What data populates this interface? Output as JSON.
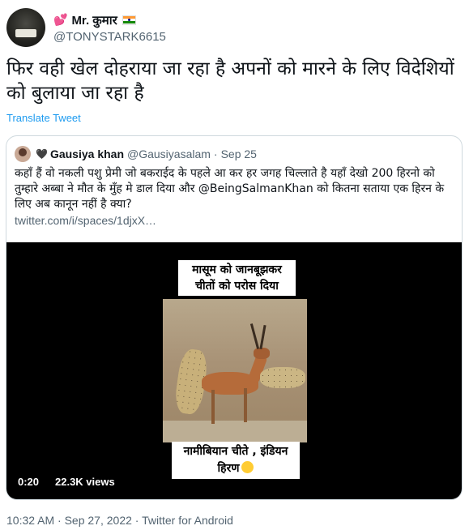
{
  "author": {
    "name": "Mr. कुमार",
    "handle": "@TONYSTARK6615",
    "avatar_icon": "profile-avatar",
    "heart_icon": "💕",
    "flag_icon": "india-flag"
  },
  "tweet": {
    "text": "फिर वही खेल दोहराया जा रहा है अपनों को मारने के लिए विदेशियों को बुलाया जा रहा है",
    "translate_label": "Translate Tweet"
  },
  "quoted": {
    "name": "Gausiya khan",
    "heart_icon": "🖤",
    "handle": "@Gausiyasalam",
    "separator": "·",
    "date": "Sep 25",
    "text": "कहाँ हैं वो नकली पशु प्रेमी जो बकराईद के पहले आ कर हर जगह चिल्लाते है यहाँ देखो 200 हिरनो को तुम्हारे अब्बा ने मौत के मुँह मे डाल दिया और @BeingSalmanKhan को कितना सताया एक हिरन के लिए अब कानून नहीं है क्या?",
    "link": "twitter.com/i/spaces/1djxX…",
    "video": {
      "caption_top": "मासूम को जानबूझकर चीतों को परोस दिया",
      "caption_bottom": "नामीबियान चीते , इंडियन हिरण",
      "duration": "0:20",
      "views": "22.3K views"
    }
  },
  "meta": {
    "text": "10:32 AM · Sep 27, 2022 · Twitter for Android"
  },
  "colors": {
    "link": "#1d9bf0",
    "secondary_text": "#536471",
    "border": "#cfd9de"
  }
}
